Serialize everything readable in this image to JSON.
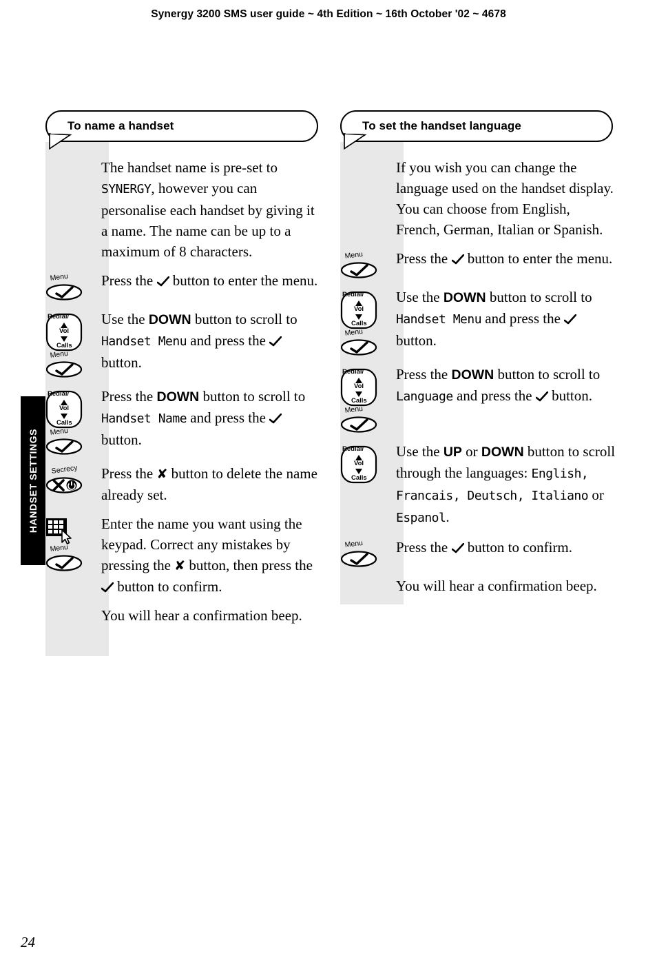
{
  "header": {
    "text": "Synergy 3200 SMS user guide ~ 4th Edition ~ 16th October '02 ~ 4678"
  },
  "side_tab": {
    "label": "HANDSET SETTINGS"
  },
  "page_number": "24",
  "icon_labels": {
    "menu": "Menu",
    "redial": "Redial/",
    "vol": "Vol",
    "calls": "Calls",
    "secrecy": "Secrecy"
  },
  "columns": [
    {
      "id": "to-name-a-handset",
      "title": "To name a handset",
      "steps": [
        {
          "icons": [],
          "text_html": "The handset name is pre-set to <span class=\"lcd\">SYNERGY</span>, however you can personalise each handset by giving it a name. The name can be up to a maximum of 8 characters."
        },
        {
          "icons": [
            "menu"
          ],
          "text_html": "Press the <span class=\"inline-tick\" data-name=\"tick-glyph\"></span> button to enter the menu."
        },
        {
          "icons": [
            "nav",
            "menu"
          ],
          "text_html": "Use the <b class=\"kw\">DOWN</b> button to scroll to <span class=\"lcd\">Handset Menu</span> and press the <span class=\"inline-tick\" data-name=\"tick-glyph\"></span> button."
        },
        {
          "icons": [
            "nav",
            "menu"
          ],
          "text_html": "Press the <b class=\"kw\">DOWN</b> button to scroll to <span class=\"lcd\">Handset Name</span> and press the <span class=\"inline-tick\" data-name=\"tick-glyph\"></span> button."
        },
        {
          "icons": [
            "secrecy"
          ],
          "text_html": "Press the <span class=\"inline-x\">&#10008;</span> button to delete the name already set."
        },
        {
          "icons": [
            "keypad",
            "menu"
          ],
          "text_html": "Enter the name you want using the keypad. Correct any mistakes by pressing the <span class=\"inline-x\">&#10008;</span> button, then press the <span class=\"inline-tick\" data-name=\"tick-glyph\"></span> button to confirm."
        },
        {
          "icons": [],
          "text_html": "You will hear a confirmation beep."
        }
      ]
    },
    {
      "id": "to-set-the-handset-language",
      "title": "To set the handset language",
      "steps": [
        {
          "icons": [],
          "text_html": "If you wish you can change the language used on the handset display. You can choose from English, French, German, Italian or Spanish."
        },
        {
          "icons": [
            "menu"
          ],
          "text_html": "Press the <span class=\"inline-tick\" data-name=\"tick-glyph\"></span> button to enter the menu."
        },
        {
          "icons": [
            "nav",
            "menu"
          ],
          "text_html": "Use the <b class=\"kw\">DOWN</b> button to scroll to <span class=\"lcd\">Handset Menu</span> and press the <span class=\"inline-tick\" data-name=\"tick-glyph\"></span> button."
        },
        {
          "icons": [
            "nav",
            "menu"
          ],
          "text_html": "Press the <b class=\"kw\">DOWN</b> button to scroll to <span class=\"lcd\">Language</span> and press the <span class=\"inline-tick\" data-name=\"tick-glyph\"></span> button."
        },
        {
          "icons": [
            "nav"
          ],
          "text_html": "Use the <b class=\"kw\">UP</b> or <b class=\"kw\">DOWN</b> button to scroll through the languages: <span class=\"lcd\">English, Francais, Deutsch, Italiano</span> or <span class=\"lcd\">Espanol</span>."
        },
        {
          "icons": [
            "menu"
          ],
          "text_html": "Press the <span class=\"inline-tick\" data-name=\"tick-glyph\"></span> button to confirm."
        },
        {
          "icons": [],
          "text_html": "You will hear a confirmation beep."
        }
      ]
    }
  ]
}
